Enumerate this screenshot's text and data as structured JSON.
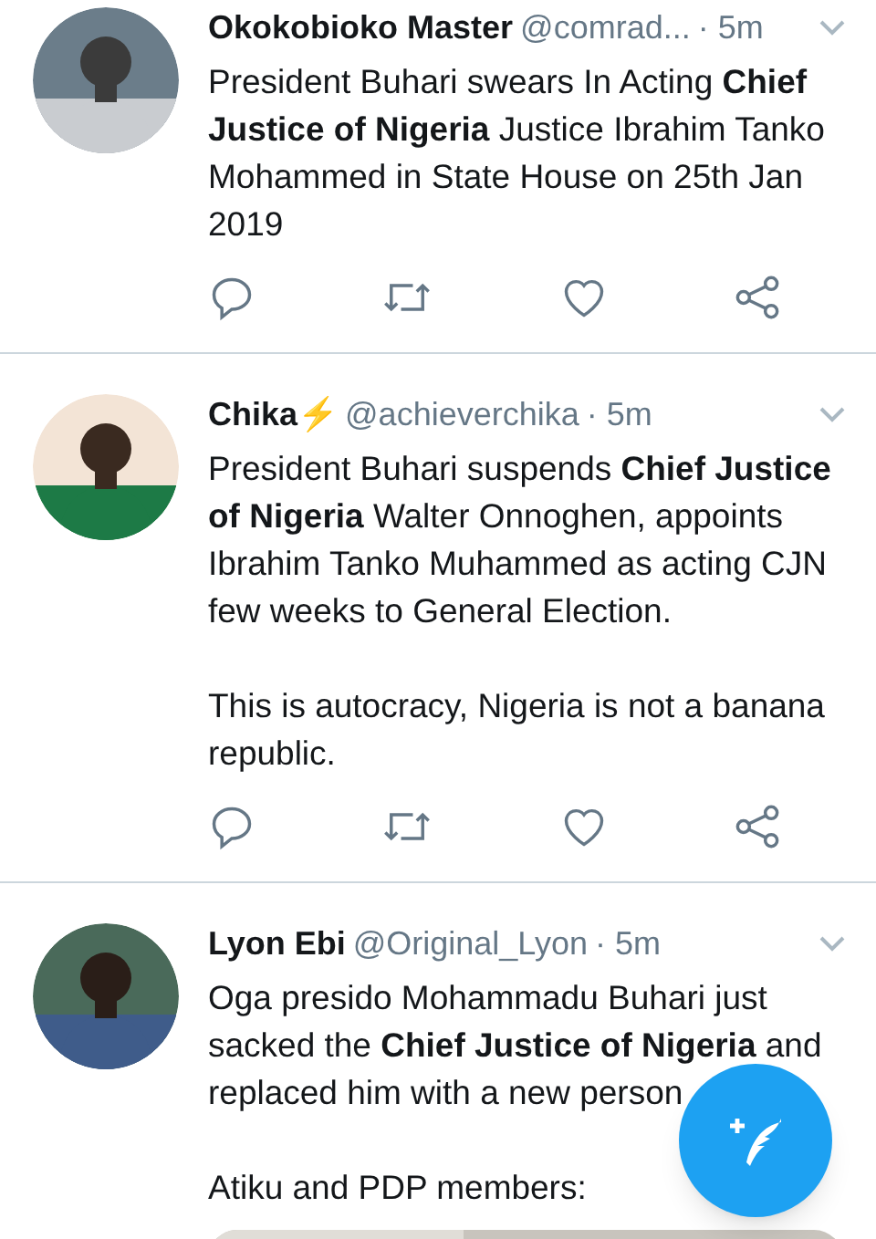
{
  "tweets": [
    {
      "name": "Okokobioko Master",
      "handle": "@comrad...",
      "time": "· 5m",
      "avatar": {
        "kind": "picture"
      },
      "paragraphs": [
        "President Buhari swears In Acting **Chief Justice of Nigeria** Justice Ibrahim Tanko Mohammed in State House on 25th Jan 2019"
      ],
      "actions": true
    },
    {
      "name": "Chika⚡",
      "handle": "@achieverchika",
      "time": "· 5m",
      "avatar": {
        "kind": "picture"
      },
      "paragraphs": [
        "President Buhari suspends **Chief Justice of Nigeria** Walter Onnoghen, appoints Ibrahim Tanko Muhammed as acting CJN few weeks to General Election.",
        "This is autocracy, Nigeria is not a banana republic."
      ],
      "actions": true
    },
    {
      "name": "Lyon Ebi",
      "handle": "@Original_Lyon",
      "time": "· 5m",
      "avatar": {
        "kind": "picture"
      },
      "paragraphs": [
        "Oga presido Mohammadu Buhari just sacked the **Chief Justice of Nigeria** and replaced him with a new person",
        "Atiku and PDP members:"
      ],
      "media": {
        "kind": "picture"
      },
      "actions": false
    }
  ],
  "compose": {
    "kind": "fab"
  }
}
